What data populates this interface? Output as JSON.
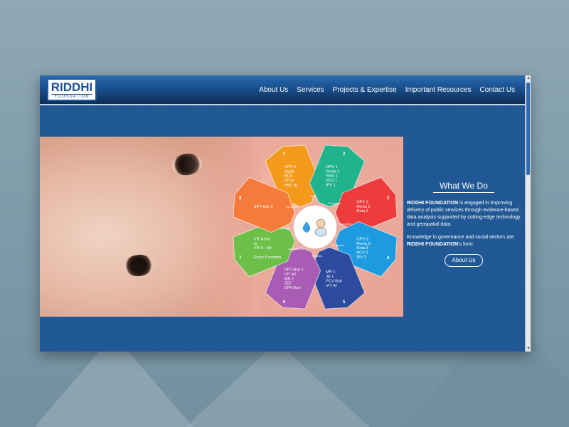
{
  "logo": {
    "main": "RIDDHI",
    "sub": "FOUNDATION"
  },
  "nav": [
    {
      "label": "About Us"
    },
    {
      "label": "Services"
    },
    {
      "label": "Projects & Expertise"
    },
    {
      "label": "Important Resources"
    },
    {
      "label": "Contact Us"
    }
  ],
  "wheel": {
    "petals": [
      {
        "num": "1",
        "color": "#f39a1c",
        "lines": [
          "OPV 0",
          "HepB",
          "BCG",
          "VIT-K",
          "Hep -Ig"
        ]
      },
      {
        "num": "2",
        "color": "#20b38e",
        "lines": [
          "OPV 1",
          "Penta 1",
          "Rota 1",
          "PCV 1",
          "IPV 1"
        ]
      },
      {
        "num": "3",
        "color": "#ee3b3b",
        "lines": [
          "OPV 2",
          "Penta 2",
          "Rota 2"
        ]
      },
      {
        "num": "4",
        "color": "#1e9be0",
        "lines": [
          "OPV 3",
          "Penta 3",
          "Rota 3",
          "PCV 2",
          "IPV 2"
        ]
      },
      {
        "num": "5",
        "color": "#2c4a9e",
        "lines": [
          "MR 1",
          "JE 1",
          "PCV Bstr",
          "VIT AI"
        ]
      },
      {
        "num": "6",
        "color": "#a85cb4",
        "lines": [
          "DPT-Bstr 1",
          "VIT A2",
          "MR 2",
          "JE2",
          "OPV-Bstr"
        ]
      },
      {
        "num": "7",
        "color": "#6cc04a",
        "lines": [
          "VIT A 3rd",
          "to",
          "VIT A - 9th",
          "",
          "Every 6 months"
        ]
      },
      {
        "num": "8",
        "color": "#f47b3a",
        "lines": [
          "DPT-Bstr 2"
        ]
      }
    ],
    "ring_labels": [
      "Day 0",
      "1.5 months",
      "2.5 months",
      "3.5 months",
      "9 months",
      "16-24 months",
      "5-6 years",
      "16 months"
    ]
  },
  "side": {
    "title": "What We Do",
    "p1_bold": "RIDDHI FOUNDATION",
    "p1_rest": " is engaged in improving delivery of public services through evidence-based data analysis supported by cutting-edge technology and geospatial data.",
    "p2_start": "Knowledge in governance and social sectors are ",
    "p2_bold": "RIDDHI FOUNDATION",
    "p2_end": "'s forte.",
    "button": "About Us"
  }
}
